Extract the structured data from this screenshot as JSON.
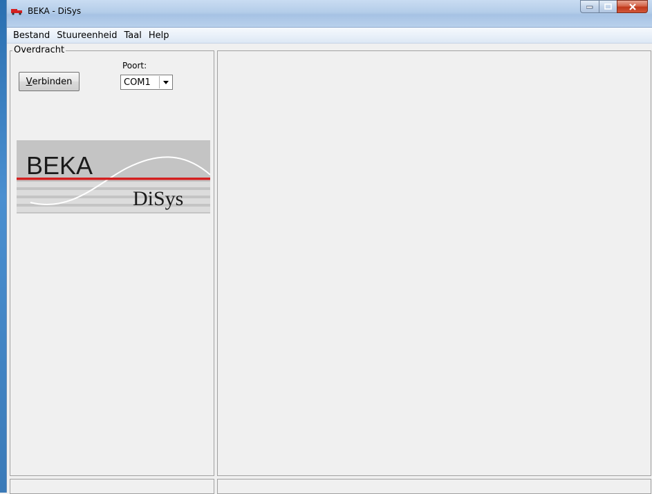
{
  "window": {
    "title": "BEKA - DiSys"
  },
  "menu": {
    "items": [
      "Bestand",
      "Stuureenheid",
      "Taal",
      "Help"
    ]
  },
  "transfer": {
    "group_label": "Overdracht",
    "connect_first_letter": "V",
    "connect_rest": "erbinden",
    "port_label": "Poort:",
    "port_value": "COM1"
  },
  "logo": {
    "brand": "BEKA",
    "product": "DiSys"
  },
  "colors": {
    "logo_red": "#d42020",
    "logo_gray": "#c4c4c4"
  }
}
